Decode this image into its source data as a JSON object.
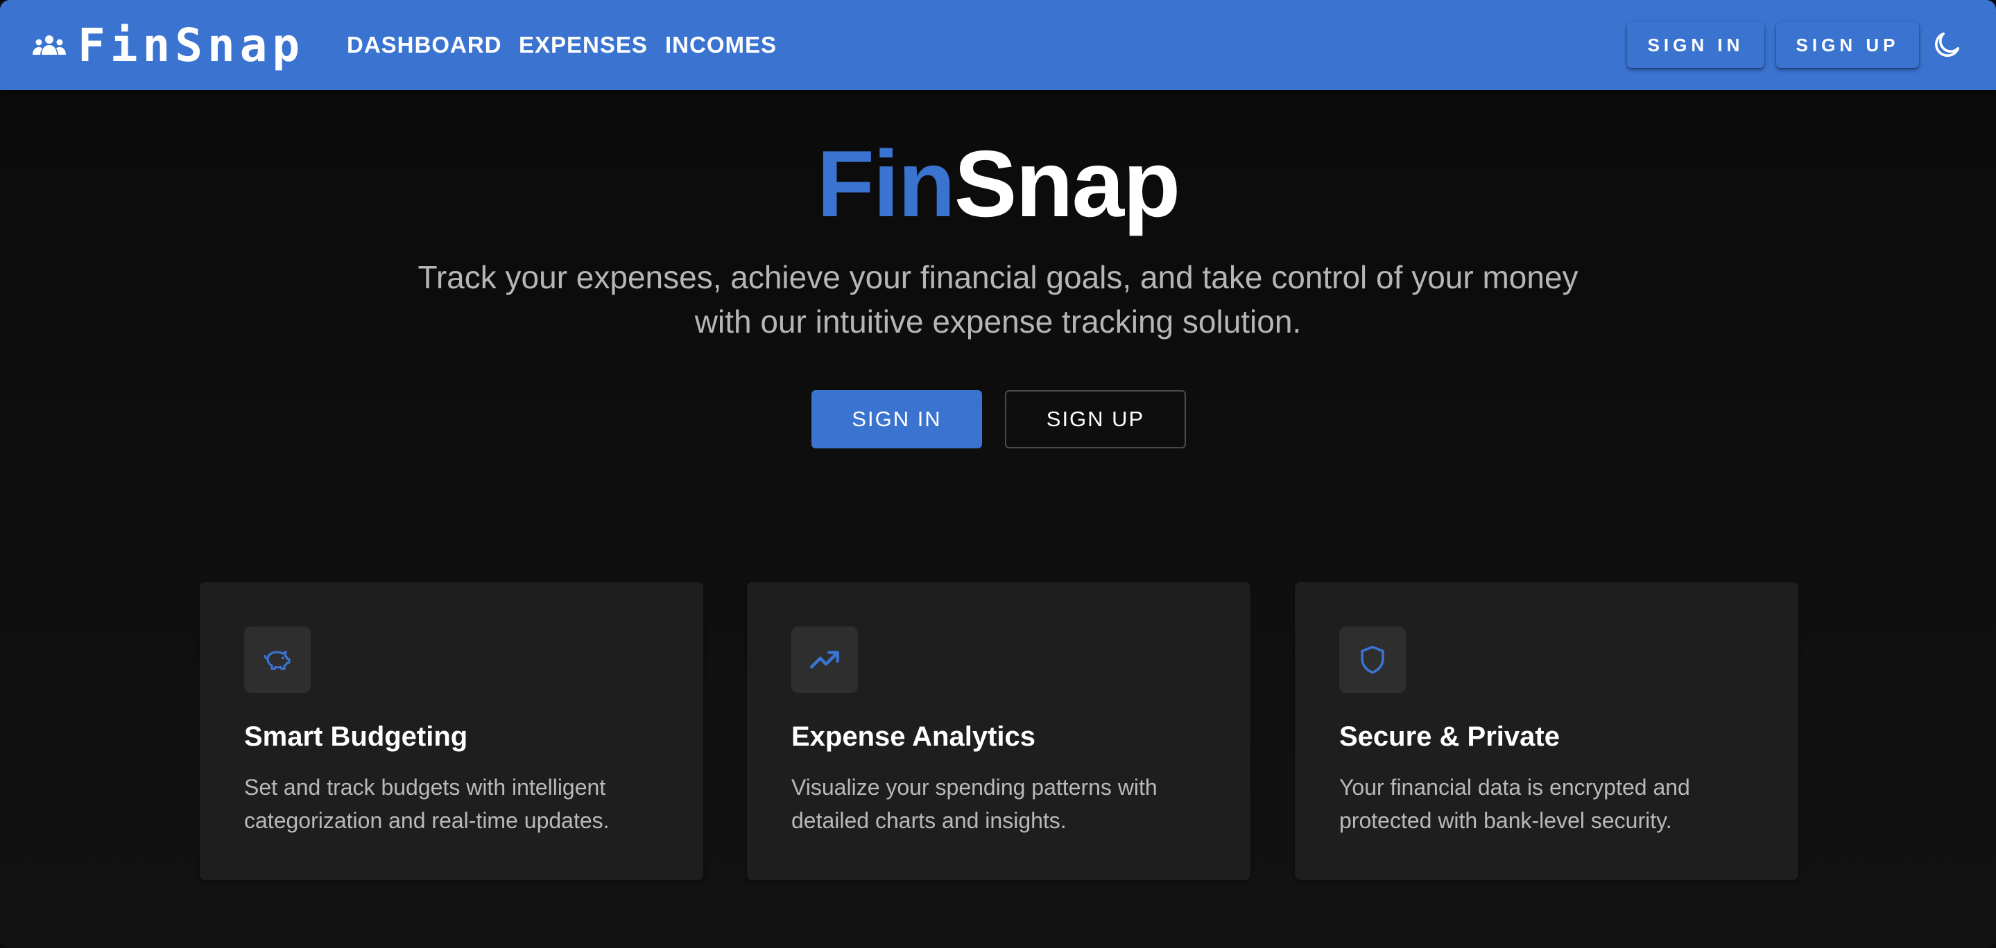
{
  "header": {
    "brand": "FinSnap",
    "brand_icon": "groups-icon",
    "nav": [
      {
        "label": "DASHBOARD"
      },
      {
        "label": "EXPENSES"
      },
      {
        "label": "INCOMES"
      }
    ],
    "signin_label": "SIGN IN",
    "signup_label": "SIGN UP",
    "theme_toggle_icon": "moon-icon"
  },
  "hero": {
    "title_part1": "Fin",
    "title_part2": "Snap",
    "subtitle": "Track your expenses, achieve your financial goals, and take control of your money with our intuitive expense tracking solution.",
    "signin_label": "SIGN IN",
    "signup_label": "SIGN UP"
  },
  "features": [
    {
      "icon": "piggy-bank-icon",
      "title": "Smart Budgeting",
      "description": "Set and track budgets with intelligent categorization and real-time updates."
    },
    {
      "icon": "trending-up-icon",
      "title": "Expense Analytics",
      "description": "Visualize your spending patterns with detailed charts and insights."
    },
    {
      "icon": "shield-icon",
      "title": "Secure & Private",
      "description": "Your financial data is encrypted and protected with bank-level security."
    }
  ],
  "colors": {
    "primary": "#3a73d0",
    "background": "#0b0b0b",
    "card": "#1e1e1e",
    "card_icon_bg": "#2e2e2e",
    "text_secondary": "#b6b6b6"
  }
}
